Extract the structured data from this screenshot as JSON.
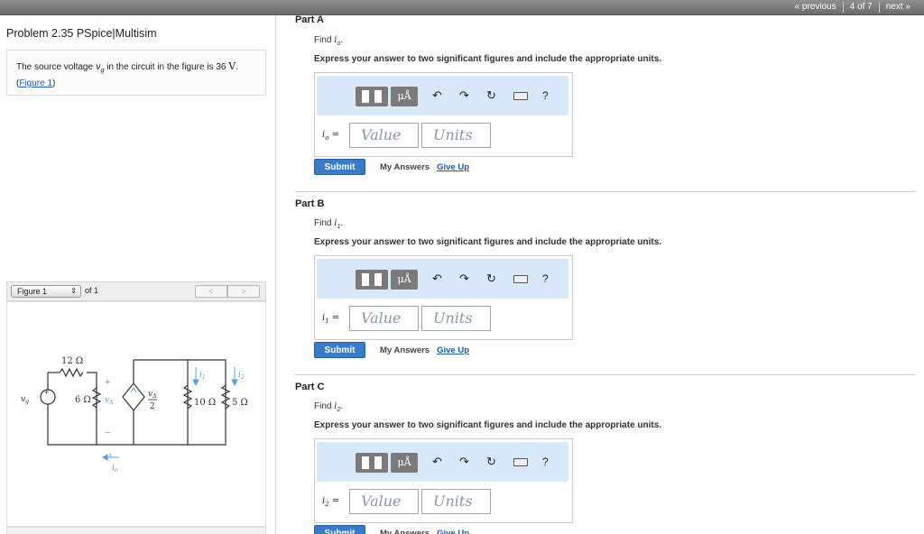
{
  "nav": {
    "previous": "« previous",
    "position": "4 of 7",
    "next": "next »"
  },
  "problem": {
    "title": "Problem 2.35 PSpice|Multisim",
    "text_before": "The source voltage",
    "var": "v",
    "var_sub": "g",
    "text_after": "in the circuit in the figure is 36",
    "unit": "V",
    "period": ".",
    "figure_link": "Figure 1"
  },
  "figure": {
    "select_label": "Figure 1",
    "of_label": "of 1",
    "prev": "<",
    "next": ">",
    "labels": {
      "r12": "12 Ω",
      "r6": "6 Ω",
      "r10": "10 Ω",
      "r5": "5 Ω",
      "vg": "v",
      "vg_sub": "g",
      "vdelta": "v",
      "vdelta_sub": "Δ",
      "dep_num": "v",
      "dep_num_sub": "Δ",
      "dep_den": "2",
      "i1": "i",
      "i1_sub": "1",
      "i2": "i",
      "i2_sub": "2",
      "io": "i",
      "io_sub": "o",
      "plus": "+",
      "minus": "−"
    },
    "colors": {
      "wire": "#333333",
      "annot": "#5aa0d8"
    }
  },
  "toolbar": {
    "mu": "μÅ",
    "undo": "↶",
    "redo": "↷",
    "reset": "↻",
    "help": "?"
  },
  "common": {
    "express": "Express your answer to two significant figures and include the appropriate units.",
    "value_placeholder": "Value",
    "units_placeholder": "Units",
    "submit": "Submit",
    "my_answers": "My Answers",
    "give_up": "Give Up"
  },
  "parts": [
    {
      "label": "Part A",
      "find_prefix": "Find",
      "var": "i",
      "sub": "o",
      "find_suffix": ".",
      "eq": "="
    },
    {
      "label": "Part B",
      "find_prefix": "Find",
      "var": "i",
      "sub": "1",
      "find_suffix": ".",
      "eq": "="
    },
    {
      "label": "Part C",
      "find_prefix": "Find",
      "var": "i",
      "sub": "2",
      "find_suffix": ".",
      "eq": "="
    }
  ]
}
